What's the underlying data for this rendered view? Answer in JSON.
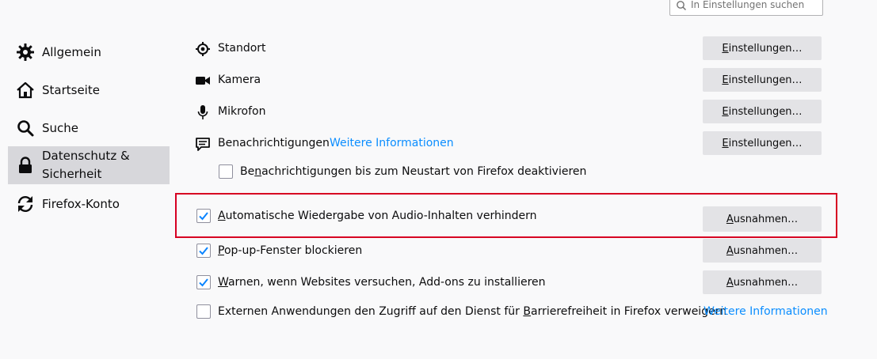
{
  "search": {
    "placeholder": "In Einstellungen suchen"
  },
  "sidebar": {
    "items": [
      {
        "label": "Allgemein",
        "icon": "gear-icon"
      },
      {
        "label": "Startseite",
        "icon": "home-icon"
      },
      {
        "label": "Suche",
        "icon": "search-icon"
      },
      {
        "label_line1": "Datenschutz &",
        "label_line2": "Sicherheit",
        "icon": "lock-icon",
        "active": true
      },
      {
        "label": "Firefox-Konto",
        "icon": "sync-icon"
      }
    ]
  },
  "permissions": {
    "location": {
      "label": "Standort",
      "icon": "location-icon",
      "button_pre": "",
      "button_u": "E",
      "button_post": "instellungen…"
    },
    "camera": {
      "label": "Kamera",
      "icon": "camera-icon",
      "button_pre": "",
      "button_u": "E",
      "button_post": "instellungen…"
    },
    "microphone": {
      "label": "Mikrofon",
      "icon": "microphone-icon",
      "button_pre": "",
      "button_u": "E",
      "button_post": "instellungen…"
    },
    "notifications": {
      "label": "Benachrichtigungen",
      "icon": "notification-icon",
      "link": "Weitere Informationen",
      "button_pre": "",
      "button_u": "E",
      "button_post": "instellungen…",
      "pause_pre": "Be",
      "pause_u": "n",
      "pause_post": "achrichtigungen bis zum Neustart von Firefox deaktivieren",
      "pause_checked": false
    }
  },
  "blocking": {
    "autoplay": {
      "pre": "",
      "u": "A",
      "post": "utomatische Wiedergabe von Audio-Inhalten verhindern",
      "checked": true,
      "button_pre": "",
      "button_u": "A",
      "button_post": "usnahmen…"
    },
    "popups": {
      "pre": "",
      "u": "P",
      "post": "op-up-Fenster blockieren",
      "checked": true,
      "button_pre": "",
      "button_u": "A",
      "button_post": "usnahmen…"
    },
    "addons": {
      "pre": "",
      "u": "W",
      "post": "arnen, wenn Websites versuchen, Add-ons zu installieren",
      "checked": true,
      "button_pre": "",
      "button_u": "A",
      "button_post": "usnahmen…"
    },
    "a11y": {
      "pre": "Externen Anwendungen den Zugriff auf den Dienst für ",
      "u": "B",
      "post": "arrierefreiheit in Firefox verweigern",
      "checked": false,
      "link": "Weitere Informationen"
    }
  },
  "colors": {
    "accent": "#0a8dff",
    "highlight": "#d70022",
    "checkbox": "#0a84ff"
  }
}
